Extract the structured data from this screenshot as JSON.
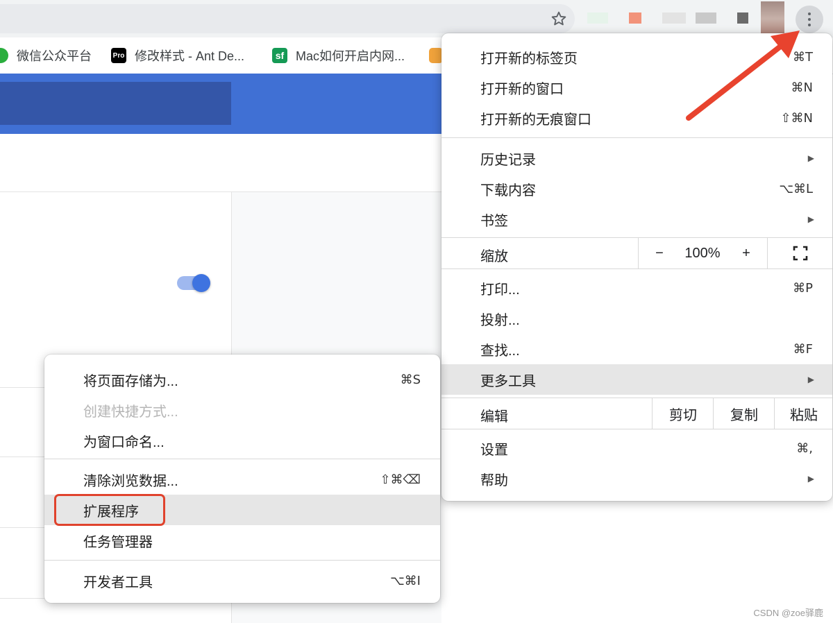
{
  "bookmarks": [
    {
      "label": "微信公众平台",
      "icon": "wechat-icon",
      "color": "#2aae3d"
    },
    {
      "label": "修改样式 - Ant De...",
      "icon": "pro-icon",
      "icon_text": "Pro",
      "color": "#000000"
    },
    {
      "label": "Mac如何开启内网...",
      "icon": "sf-icon",
      "icon_text": "sf",
      "color": "#159a55"
    }
  ],
  "main_menu": {
    "items": [
      {
        "label": "打开新的标签页",
        "shortcut": "⌘T"
      },
      {
        "label": "打开新的窗口",
        "shortcut": "⌘N"
      },
      {
        "label": "打开新的无痕窗口",
        "shortcut": "⇧⌘N"
      },
      {
        "label": "历史记录",
        "arrow": "▶"
      },
      {
        "label": "下载内容",
        "shortcut": "⌥⌘L"
      },
      {
        "label": "书签",
        "arrow": "▶"
      },
      {
        "label": "打印...",
        "shortcut": "⌘P"
      },
      {
        "label": "投射..."
      },
      {
        "label": "查找...",
        "shortcut": "⌘F"
      },
      {
        "label": "更多工具",
        "arrow": "▶"
      },
      {
        "label": "设置",
        "shortcut": "⌘,"
      },
      {
        "label": "帮助",
        "arrow": "▶"
      }
    ],
    "zoom": {
      "label": "缩放",
      "minus": "−",
      "value": "100%",
      "plus": "+"
    },
    "edit": {
      "label": "编辑",
      "cut": "剪切",
      "copy": "复制",
      "paste": "粘贴"
    }
  },
  "submenu": {
    "items": [
      {
        "label": "将页面存储为...",
        "shortcut": "⌘S"
      },
      {
        "label": "创建快捷方式..."
      },
      {
        "label": "为窗口命名..."
      },
      {
        "label": "清除浏览数据...",
        "shortcut": "⇧⌘⌫"
      },
      {
        "label": "扩展程序"
      },
      {
        "label": "任务管理器"
      },
      {
        "label": "开发者工具",
        "shortcut": "⌥⌘I"
      }
    ]
  },
  "watermark": "CSDN @zoe驿鹿",
  "colors": {
    "banner": "#4070d4",
    "highlight_box": "#e0432d",
    "arrow": "#e8432e",
    "toggle": "#3e73e0"
  }
}
